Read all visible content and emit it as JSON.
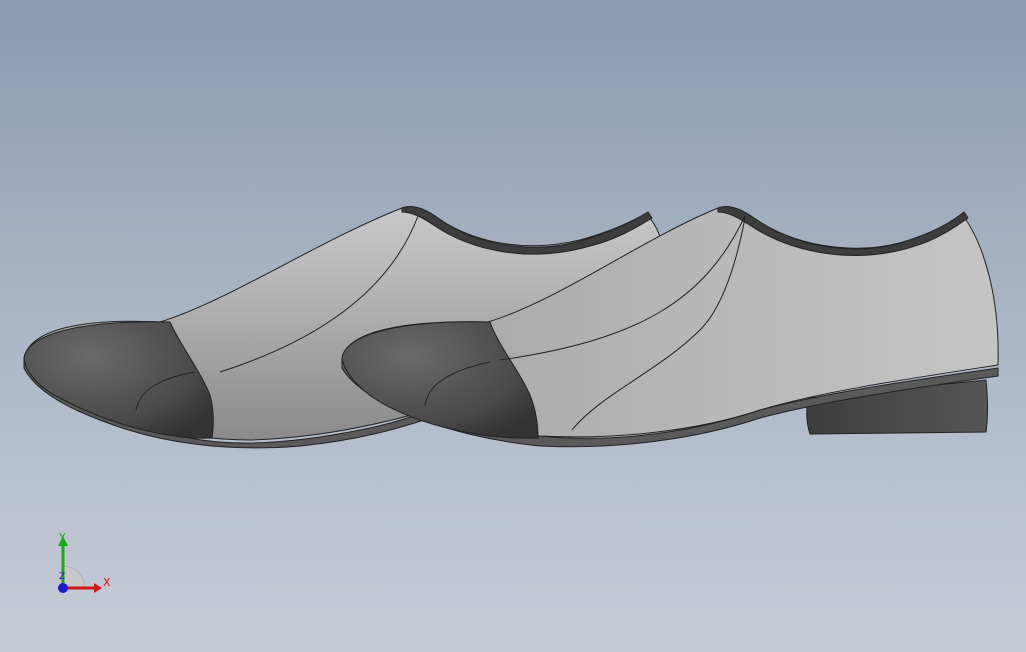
{
  "viewport": {
    "background_top": "#8a9bb0",
    "background_bottom": "#c7ccd6"
  },
  "model": {
    "parts": [
      {
        "name": "shoe-rear"
      },
      {
        "name": "shoe-front"
      }
    ],
    "colors": {
      "upper": "#b2b2b2",
      "toe_cap": "#4e4e4e",
      "collar": "#3d3d3d",
      "sole": "#5a5a5a",
      "heel": "#454545"
    }
  },
  "triad": {
    "x_label": "X",
    "y_label": "Y",
    "z_label": "Z",
    "x_color": "#d01818",
    "y_color": "#1aa81a",
    "z_color": "#1a1ad0"
  }
}
